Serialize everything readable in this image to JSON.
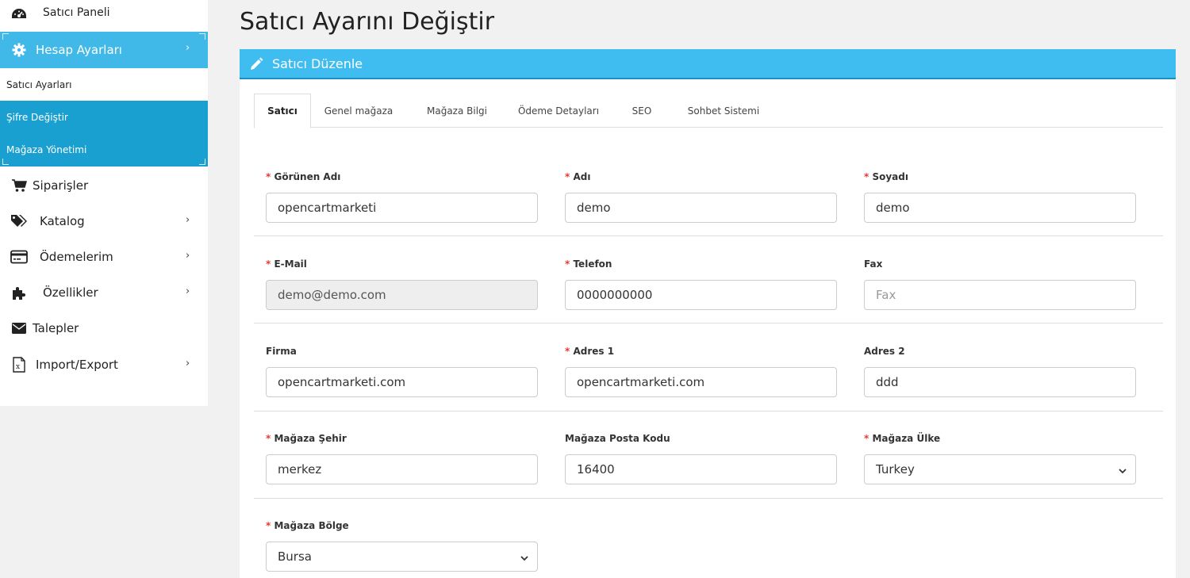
{
  "sidebar": {
    "dashboard": "Satıcı Paneli",
    "account": "Hesap Ayarları",
    "account_chevron": "›",
    "sub_items": [
      "Satıcı Ayarları",
      "Şifre Değiştir",
      "Mağaza Yönetimi"
    ],
    "orders": "Siparişler",
    "catalog": "Katalog",
    "payments": "Ödemelerim",
    "features": "Özellikler",
    "requests": "Talepler",
    "import_export": "Import/Export",
    "chevron": "›"
  },
  "page": {
    "title": "Satıcı Ayarını Değiştir",
    "panel_title": "Satıcı Düzenle"
  },
  "tabs": [
    "Satıcı",
    "Genel mağaza",
    "Mağaza Bilgi",
    "Ödeme Detayları",
    "SEO",
    "Sohbet Sistemi"
  ],
  "form": {
    "required_mark": "*",
    "display_name": {
      "label": "Görünen Adı",
      "value": "opencartmarketi"
    },
    "first_name": {
      "label": "Adı",
      "value": "demo"
    },
    "last_name": {
      "label": "Soyadı",
      "value": "demo"
    },
    "email": {
      "label": "E-Mail",
      "value": "demo@demo.com"
    },
    "phone": {
      "label": "Telefon",
      "value": "0000000000"
    },
    "fax": {
      "label": "Fax",
      "placeholder": "Fax"
    },
    "company": {
      "label": "Firma",
      "value": "opencartmarketi.com"
    },
    "address1": {
      "label": "Adres 1",
      "value": "opencartmarketi.com"
    },
    "address2": {
      "label": "Adres 2",
      "value": "ddd"
    },
    "city": {
      "label": "Mağaza Şehir",
      "value": "merkez"
    },
    "postcode": {
      "label": "Mağaza Posta Kodu",
      "value": "16400"
    },
    "country": {
      "label": "Mağaza Ülke",
      "value": "Turkey"
    },
    "region": {
      "label": "Mağaza Bölge",
      "value": "Bursa"
    }
  },
  "colors": {
    "accent": "#40bdf0",
    "sidebar_active": "#40b9e8",
    "sidebar_sub_active": "#1aa0d0",
    "required": "#e53935"
  }
}
